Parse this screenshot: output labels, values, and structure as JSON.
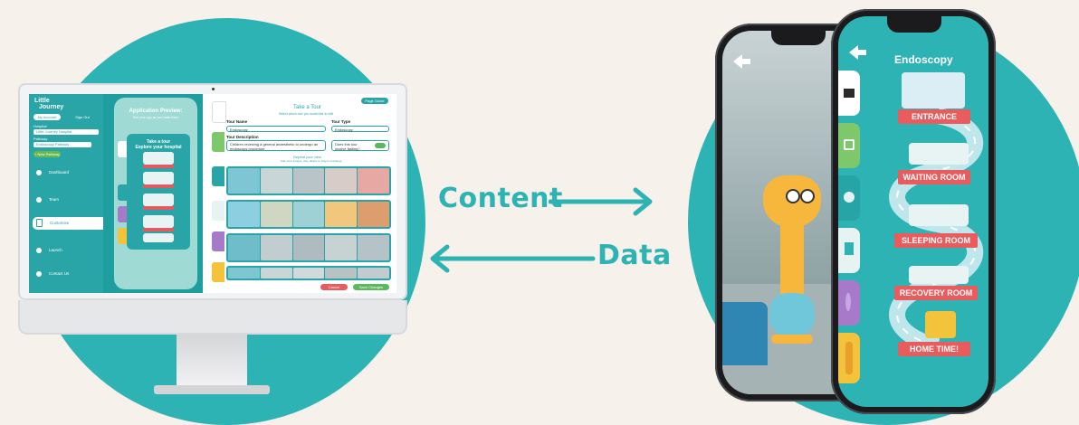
{
  "colors": {
    "teal": "#2eb3b4",
    "background": "#f6f1ea",
    "red": "#e85c5e",
    "green": "#5cb85c"
  },
  "labels": {
    "content": "Content",
    "data": "Data"
  },
  "desktop": {
    "sidebar": {
      "logo_line1": "Little",
      "logo_line2": "Journey",
      "my_account": "My Account",
      "sign_out": "Sign Out",
      "hospital_label": "Hospital",
      "hospital_value": "Little Journey Hospital",
      "pathway_label": "Pathway",
      "pathway_value": "Endoscopy Pathway",
      "new_pathway": "+ New Pathway",
      "nav": [
        "Dashboard",
        "Team",
        "Customise",
        "Launch",
        "Contact Us"
      ]
    },
    "preview": {
      "title": "Application Preview:",
      "subtitle": "See your app as you make them",
      "phone_title_1": "Take a tour",
      "phone_title_2": "Explore your hospital"
    },
    "form": {
      "page_guide": "Page Guide",
      "heading": "Take a Tour",
      "subheading": "Select which tour you would like to edit",
      "tour_name_label": "Tour Name",
      "tour_name_value": "Endoscopy",
      "tour_type_label": "Tour Type",
      "tour_type_value": "Endoscopy",
      "tour_desc_label": "Tour Description",
      "tour_desc_value": "Children receiving a general anaesthetic to undergo an endoscopy procedure",
      "toggle_label": "Does this tour involve fasting?",
      "panorama_heading": "Repeat your view",
      "panorama_sub": "Add more images, then delete or drag to rearrange",
      "cancel": "Cancel",
      "save": "Save Changes"
    }
  },
  "phone_right": {
    "title": "Endoscopy",
    "stops": [
      "ENTRANCE",
      "WAITING ROOM",
      "SLEEPING ROOM",
      "RECOVERY ROOM",
      "HOME TIME!"
    ]
  },
  "icons": [
    "home-icon",
    "back-arrow-icon",
    "calendar-icon",
    "badge-icon",
    "document-icon",
    "feather-icon",
    "shapes-icon",
    "arrow-right-icon",
    "arrow-left-icon"
  ]
}
